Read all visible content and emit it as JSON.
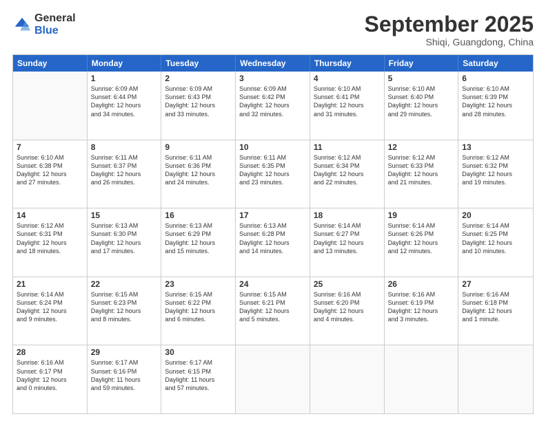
{
  "logo": {
    "general": "General",
    "blue": "Blue"
  },
  "title": "September 2025",
  "subtitle": "Shiqi, Guangdong, China",
  "header_days": [
    "Sunday",
    "Monday",
    "Tuesday",
    "Wednesday",
    "Thursday",
    "Friday",
    "Saturday"
  ],
  "weeks": [
    [
      {
        "day": "",
        "info": ""
      },
      {
        "day": "1",
        "info": "Sunrise: 6:09 AM\nSunset: 6:44 PM\nDaylight: 12 hours\nand 34 minutes."
      },
      {
        "day": "2",
        "info": "Sunrise: 6:09 AM\nSunset: 6:43 PM\nDaylight: 12 hours\nand 33 minutes."
      },
      {
        "day": "3",
        "info": "Sunrise: 6:09 AM\nSunset: 6:42 PM\nDaylight: 12 hours\nand 32 minutes."
      },
      {
        "day": "4",
        "info": "Sunrise: 6:10 AM\nSunset: 6:41 PM\nDaylight: 12 hours\nand 31 minutes."
      },
      {
        "day": "5",
        "info": "Sunrise: 6:10 AM\nSunset: 6:40 PM\nDaylight: 12 hours\nand 29 minutes."
      },
      {
        "day": "6",
        "info": "Sunrise: 6:10 AM\nSunset: 6:39 PM\nDaylight: 12 hours\nand 28 minutes."
      }
    ],
    [
      {
        "day": "7",
        "info": "Sunrise: 6:10 AM\nSunset: 6:38 PM\nDaylight: 12 hours\nand 27 minutes."
      },
      {
        "day": "8",
        "info": "Sunrise: 6:11 AM\nSunset: 6:37 PM\nDaylight: 12 hours\nand 26 minutes."
      },
      {
        "day": "9",
        "info": "Sunrise: 6:11 AM\nSunset: 6:36 PM\nDaylight: 12 hours\nand 24 minutes."
      },
      {
        "day": "10",
        "info": "Sunrise: 6:11 AM\nSunset: 6:35 PM\nDaylight: 12 hours\nand 23 minutes."
      },
      {
        "day": "11",
        "info": "Sunrise: 6:12 AM\nSunset: 6:34 PM\nDaylight: 12 hours\nand 22 minutes."
      },
      {
        "day": "12",
        "info": "Sunrise: 6:12 AM\nSunset: 6:33 PM\nDaylight: 12 hours\nand 21 minutes."
      },
      {
        "day": "13",
        "info": "Sunrise: 6:12 AM\nSunset: 6:32 PM\nDaylight: 12 hours\nand 19 minutes."
      }
    ],
    [
      {
        "day": "14",
        "info": "Sunrise: 6:12 AM\nSunset: 6:31 PM\nDaylight: 12 hours\nand 18 minutes."
      },
      {
        "day": "15",
        "info": "Sunrise: 6:13 AM\nSunset: 6:30 PM\nDaylight: 12 hours\nand 17 minutes."
      },
      {
        "day": "16",
        "info": "Sunrise: 6:13 AM\nSunset: 6:29 PM\nDaylight: 12 hours\nand 15 minutes."
      },
      {
        "day": "17",
        "info": "Sunrise: 6:13 AM\nSunset: 6:28 PM\nDaylight: 12 hours\nand 14 minutes."
      },
      {
        "day": "18",
        "info": "Sunrise: 6:14 AM\nSunset: 6:27 PM\nDaylight: 12 hours\nand 13 minutes."
      },
      {
        "day": "19",
        "info": "Sunrise: 6:14 AM\nSunset: 6:26 PM\nDaylight: 12 hours\nand 12 minutes."
      },
      {
        "day": "20",
        "info": "Sunrise: 6:14 AM\nSunset: 6:25 PM\nDaylight: 12 hours\nand 10 minutes."
      }
    ],
    [
      {
        "day": "21",
        "info": "Sunrise: 6:14 AM\nSunset: 6:24 PM\nDaylight: 12 hours\nand 9 minutes."
      },
      {
        "day": "22",
        "info": "Sunrise: 6:15 AM\nSunset: 6:23 PM\nDaylight: 12 hours\nand 8 minutes."
      },
      {
        "day": "23",
        "info": "Sunrise: 6:15 AM\nSunset: 6:22 PM\nDaylight: 12 hours\nand 6 minutes."
      },
      {
        "day": "24",
        "info": "Sunrise: 6:15 AM\nSunset: 6:21 PM\nDaylight: 12 hours\nand 5 minutes."
      },
      {
        "day": "25",
        "info": "Sunrise: 6:16 AM\nSunset: 6:20 PM\nDaylight: 12 hours\nand 4 minutes."
      },
      {
        "day": "26",
        "info": "Sunrise: 6:16 AM\nSunset: 6:19 PM\nDaylight: 12 hours\nand 3 minutes."
      },
      {
        "day": "27",
        "info": "Sunrise: 6:16 AM\nSunset: 6:18 PM\nDaylight: 12 hours\nand 1 minute."
      }
    ],
    [
      {
        "day": "28",
        "info": "Sunrise: 6:16 AM\nSunset: 6:17 PM\nDaylight: 12 hours\nand 0 minutes."
      },
      {
        "day": "29",
        "info": "Sunrise: 6:17 AM\nSunset: 6:16 PM\nDaylight: 11 hours\nand 59 minutes."
      },
      {
        "day": "30",
        "info": "Sunrise: 6:17 AM\nSunset: 6:15 PM\nDaylight: 11 hours\nand 57 minutes."
      },
      {
        "day": "",
        "info": ""
      },
      {
        "day": "",
        "info": ""
      },
      {
        "day": "",
        "info": ""
      },
      {
        "day": "",
        "info": ""
      }
    ]
  ]
}
